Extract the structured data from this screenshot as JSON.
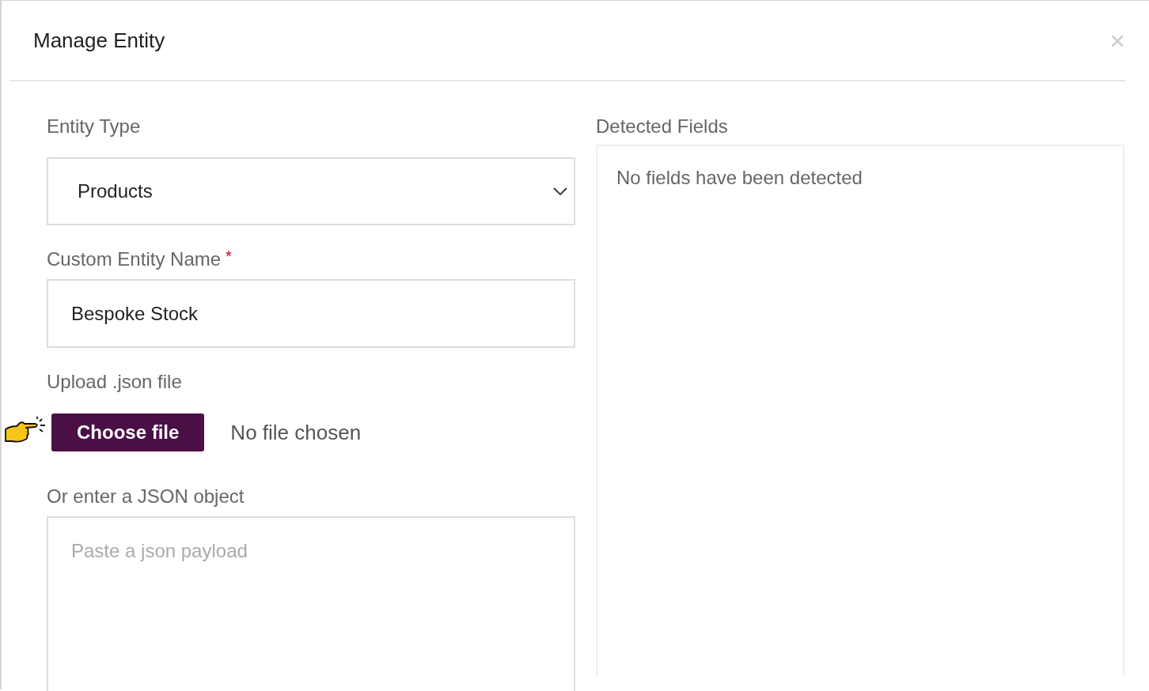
{
  "dialog": {
    "title": "Manage Entity",
    "close": "×"
  },
  "entity_type": {
    "label": "Entity Type",
    "value": "Products"
  },
  "custom_name": {
    "label": "Custom Entity Name",
    "required": true,
    "required_mark": "*",
    "value": "Bespoke Stock"
  },
  "upload": {
    "label": "Upload .json file",
    "button": "Choose file",
    "status": "No file chosen"
  },
  "json_input": {
    "label": "Or enter a JSON object",
    "placeholder": "Paste a json payload"
  },
  "detected_fields": {
    "label": "Detected Fields",
    "empty_text": "No fields have been detected"
  }
}
